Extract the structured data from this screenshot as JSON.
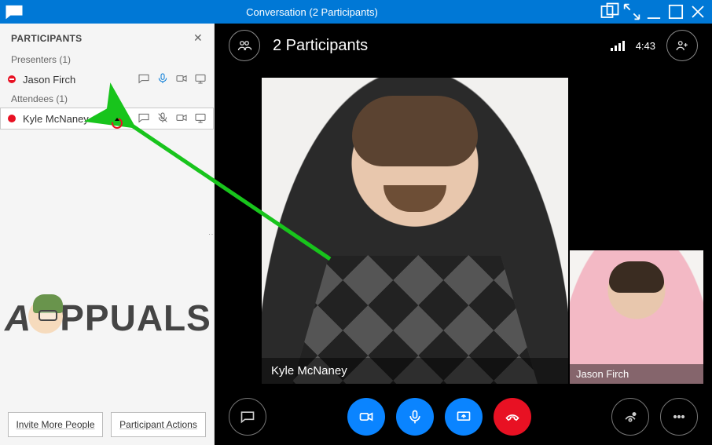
{
  "title": "Conversation (2 Participants)",
  "sidebar": {
    "header": "PARTICIPANTS",
    "presenters_label": "Presenters (1)",
    "attendees_label": "Attendees (1)",
    "presenters": [
      {
        "name": "Jason Firch",
        "status_color": "#e81123",
        "mic": "on"
      }
    ],
    "attendees": [
      {
        "name": "Kyle McNaney",
        "status_color": "#e81123",
        "mic": "off"
      }
    ],
    "footer": {
      "invite_label": "Invite More People",
      "actions_label": "Participant Actions"
    }
  },
  "stage": {
    "count_label": "2 Participants",
    "time": "4:43",
    "tiles": [
      {
        "name_label": "Kyle McNaney"
      },
      {
        "name_label": "Jason Firch"
      }
    ]
  },
  "watermark_text_1": "PPUALS"
}
